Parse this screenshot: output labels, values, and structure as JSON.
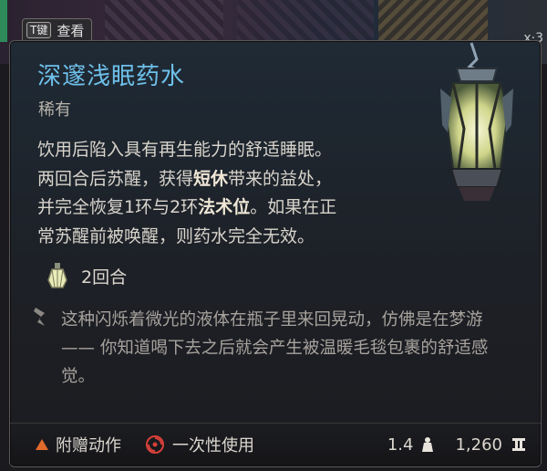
{
  "inspect_tab": {
    "key": "T键",
    "label": "查看"
  },
  "corner_text": "x·3",
  "item": {
    "name": "深邃浅眠药水",
    "rarity": "稀有",
    "description_lines": [
      [
        "饮用后陷入具有再生能力的舒适睡眠。"
      ],
      [
        "两回合后苏醒，获得",
        "短休",
        "带来的益处，"
      ],
      [
        "并完全恢复1环与2环",
        "法术位",
        "。如果在正"
      ],
      [
        "常苏醒前被唤醒，则药水完全无效。"
      ]
    ],
    "duration": "2回合",
    "flavor": "这种闪烁着微光的液体在瓶子里来回晃动，仿佛是在梦游 —— 你知道喝下去之后就会产生被温暖毛毯包裹的舒适感觉。"
  },
  "footer": {
    "action_type": "附赠动作",
    "usage": "一次性使用",
    "weight": "1.4",
    "price": "1,260"
  },
  "colors": {
    "title": "#6ec0ea",
    "bonus_action": "#e06a2c",
    "single_use": "#d6403a"
  },
  "icons": [
    "potion-lantern-icon",
    "duration-icon",
    "flavor-quill-icon",
    "bonus-action-icon",
    "single-use-icon",
    "weight-icon",
    "gold-icon"
  ]
}
